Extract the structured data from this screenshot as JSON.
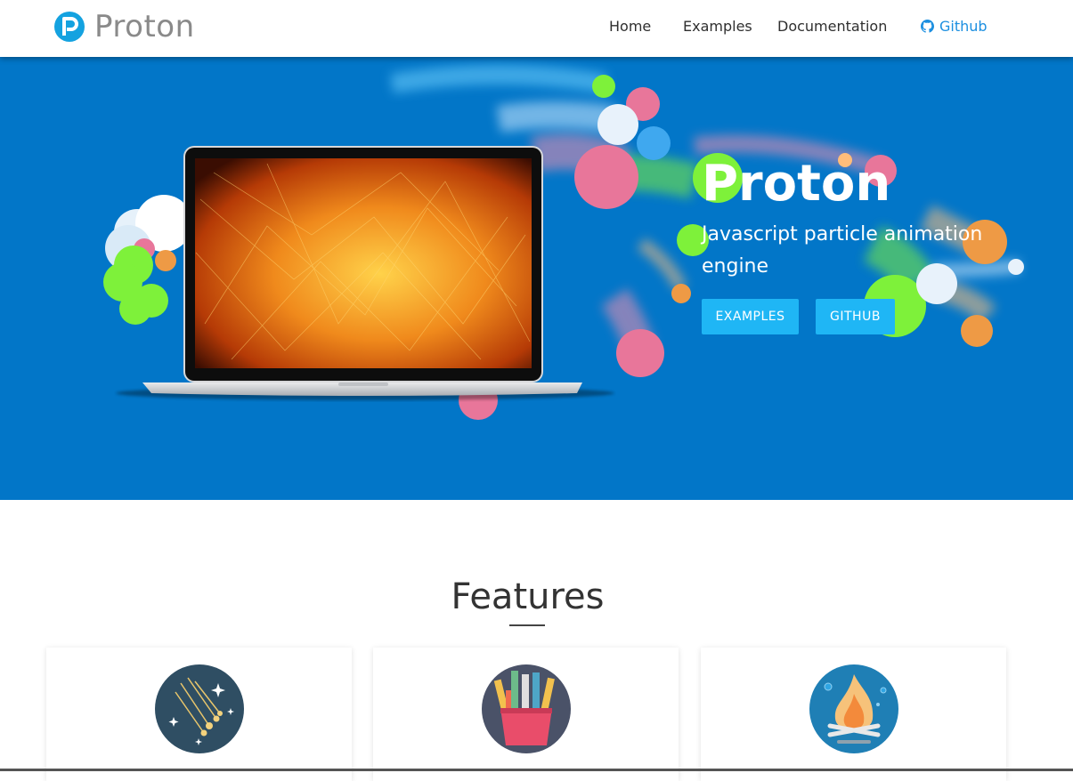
{
  "brand": {
    "name": "Proton"
  },
  "nav": {
    "home": "Home",
    "examples": "Examples",
    "documentation": "Documentation",
    "github": "Github"
  },
  "hero": {
    "title": "Proton",
    "subtitle": "Javascript particle animation engine",
    "buttons": {
      "examples": "EXAMPLES",
      "github": "GITHUB"
    },
    "background_color": "#0276c8"
  },
  "features": {
    "title": "Features",
    "cards": [
      {
        "icon": "meteor-shower-icon"
      },
      {
        "icon": "pencil-cup-icon"
      },
      {
        "icon": "campfire-icon"
      }
    ]
  },
  "colors": {
    "accent": "#1fb6f5",
    "link": "#1c8fe0",
    "particle_green": "#7ef13a",
    "particle_pink": "#e8769a",
    "particle_orange": "#ee9a45"
  }
}
